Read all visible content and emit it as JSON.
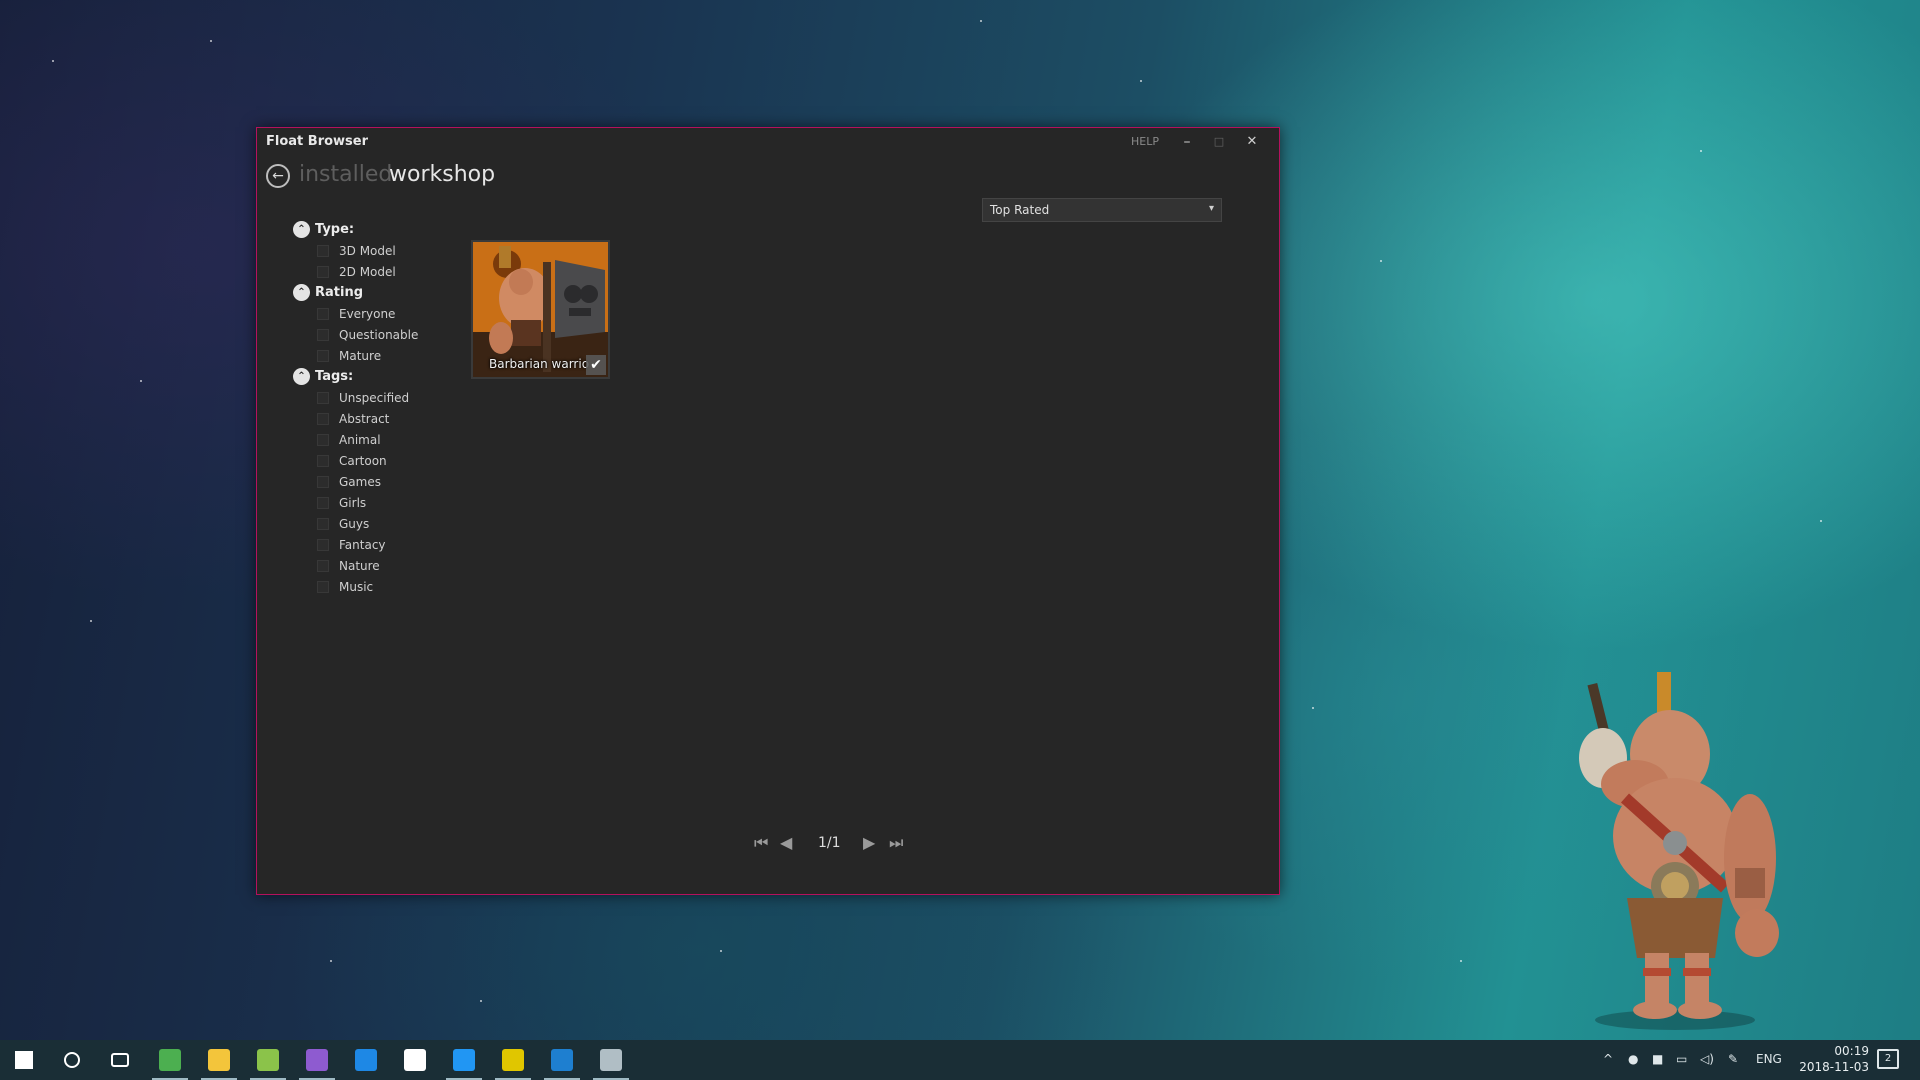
{
  "window": {
    "title": "Float Browser",
    "help_label": "HELP",
    "minimize_glyph": "–",
    "maximize_glyph": "□",
    "close_glyph": "✕",
    "accent_color": "#b5115d"
  },
  "nav": {
    "back_icon": "arrow-left-circle-icon",
    "back_glyph": "←",
    "tabs": [
      {
        "label": "installed",
        "active": false
      },
      {
        "label": "workshop",
        "active": true
      }
    ]
  },
  "sort": {
    "selected": "Top Rated",
    "chevron_glyph": "▾"
  },
  "filters": {
    "collapse_glyph": "⌃",
    "groups": [
      {
        "label": "Type:",
        "items": [
          "3D Model",
          "2D Model"
        ]
      },
      {
        "label": "Rating",
        "items": [
          "Everyone",
          "Questionable",
          "Mature"
        ]
      },
      {
        "label": "Tags:",
        "items": [
          "Unspecified",
          "Abstract",
          "Animal",
          "Cartoon",
          "Games",
          "Girls",
          "Guys",
          "Fantacy",
          "Nature",
          "Music"
        ]
      }
    ]
  },
  "items": [
    {
      "name": "Barbarian warrio",
      "installed": true,
      "check_glyph": "✔"
    }
  ],
  "pagination": {
    "first_glyph": "⏮",
    "prev_glyph": "◀",
    "current": "1/1",
    "next_glyph": "▶",
    "last_glyph": "⏭"
  },
  "taskbar": {
    "apps": [
      {
        "name": "start-icon",
        "color": "#ffffff"
      },
      {
        "name": "cortana-search-icon",
        "color": "#ffffff"
      },
      {
        "name": "task-view-icon",
        "color": "#ffffff"
      },
      {
        "name": "chrome-icon",
        "color": "#4caf50",
        "active": true
      },
      {
        "name": "file-explorer-icon",
        "color": "#f3c53b",
        "active": true
      },
      {
        "name": "notepad-plus-icon",
        "color": "#8bc34a",
        "active": true
      },
      {
        "name": "visual-studio-icon",
        "color": "#8e5bd0",
        "active": true
      },
      {
        "name": "maps-icon",
        "color": "#1e88e5"
      },
      {
        "name": "unity-icon",
        "color": "#ffffff"
      },
      {
        "name": "paint-icon",
        "color": "#2196f3",
        "active": true
      },
      {
        "name": "float-app-icon",
        "color": "#e0c600",
        "active": true
      },
      {
        "name": "float-browser-icon",
        "color": "#1e7fd0",
        "active": true
      },
      {
        "name": "mascot-app-icon",
        "color": "#b0bec5",
        "active": true
      }
    ],
    "tray": {
      "chevron_glyph": "^",
      "language": "ENG",
      "time": "00:19",
      "date": "2018-11-03",
      "notification_count": "2"
    }
  }
}
